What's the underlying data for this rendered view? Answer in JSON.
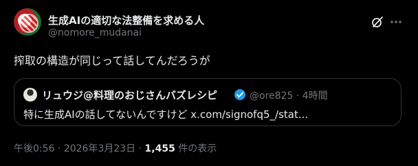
{
  "author": {
    "name": "生成AIの適切な法整備を求める人",
    "handle": "@nomore_mudanai"
  },
  "post": {
    "text": "搾取の構造が同じって話してんだろうが"
  },
  "quote": {
    "name": "リュウジ@料理のおじさんバズレシピ",
    "handle": "@ore825",
    "separator": "·",
    "time": "4時間",
    "text": "特に生成AIの話してないんですけど x.com/signofq5_/stat..."
  },
  "meta": {
    "time": "午後0:56",
    "sep1": "·",
    "date": "2026年3月23日",
    "sep2": "·",
    "views_count": "1,455",
    "views_label": "件の表示"
  },
  "icons": {
    "grok": "grok-icon",
    "more": "more-icon",
    "verified": "verified-badge-icon"
  },
  "colors": {
    "background": "#000000",
    "text": "#e7e9ea",
    "muted": "#71767b",
    "border": "#2f3336",
    "verified": "#1d9bf0"
  }
}
